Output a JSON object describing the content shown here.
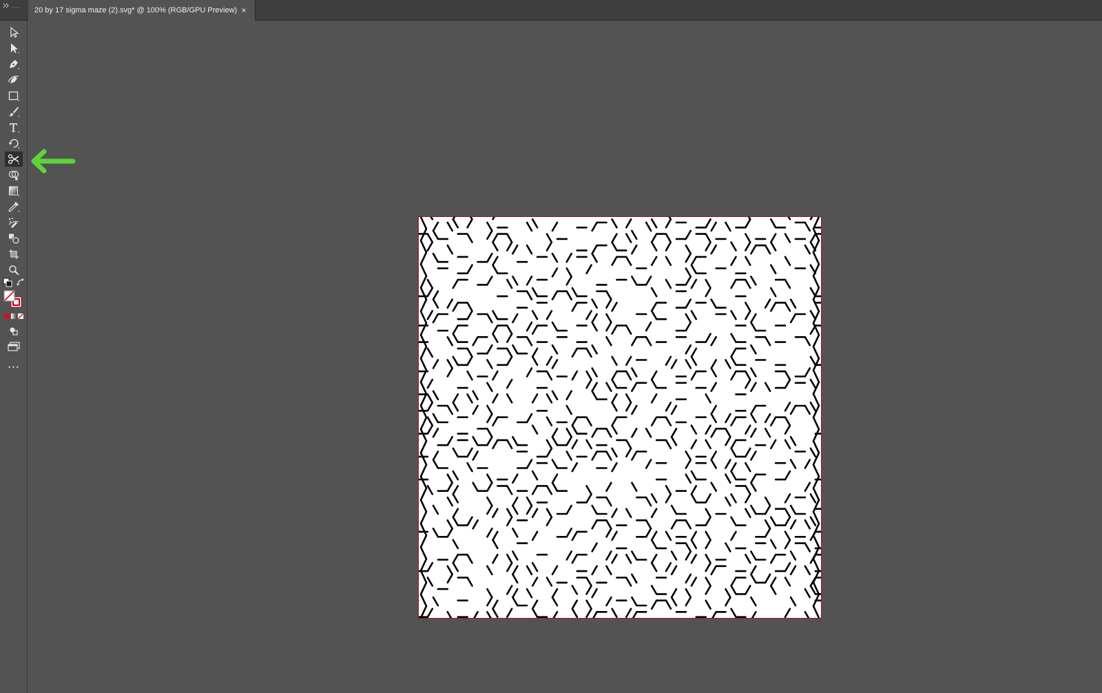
{
  "document": {
    "tab_title": "20 by 17 sigma maze (2).svg* @ 100% (RGB/GPU Preview)",
    "close_glyph": "×"
  },
  "toolbar": {
    "more_glyph": "•••",
    "tools": [
      {
        "name": "selection-tool",
        "icon": "arrow-outline-icon"
      },
      {
        "name": "direct-selection-tool",
        "icon": "arrow-solid-icon"
      },
      {
        "name": "pen-tool",
        "icon": "pen-icon"
      },
      {
        "name": "curvature-tool",
        "icon": "curvature-icon"
      },
      {
        "name": "rectangle-tool",
        "icon": "rectangle-icon"
      },
      {
        "name": "paintbrush-tool",
        "icon": "brush-icon"
      },
      {
        "name": "type-tool",
        "icon": "type-icon"
      },
      {
        "name": "rotate-tool",
        "icon": "rotate-icon"
      },
      {
        "name": "scissors-tool",
        "icon": "scissors-icon",
        "active": true
      },
      {
        "name": "shape-builder-tool",
        "icon": "shape-builder-icon"
      },
      {
        "name": "gradient-tool",
        "icon": "gradient-icon"
      },
      {
        "name": "eyedropper-tool",
        "icon": "eyedropper-icon"
      },
      {
        "name": "symbol-sprayer-tool",
        "icon": "sprayer-icon"
      },
      {
        "name": "blend-tool",
        "icon": "blend-icon"
      },
      {
        "name": "artboard-tool",
        "icon": "artboard-icon"
      },
      {
        "name": "zoom-tool",
        "icon": "zoom-icon"
      }
    ]
  },
  "colors": {
    "ui_dark": "#3e3e3e",
    "ui_mid": "#535353",
    "artboard_border": "#a0141e",
    "annotation_arrow": "#5fd43a",
    "maze_stroke": "#000000"
  },
  "annotation": {
    "type": "arrow",
    "points_to": "scissors-tool"
  }
}
